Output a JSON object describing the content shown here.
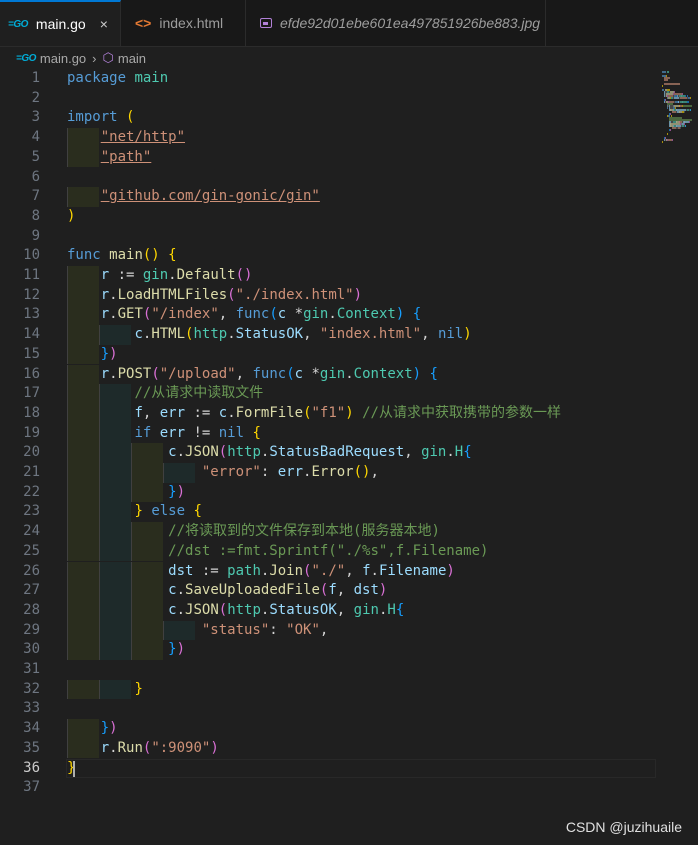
{
  "tabs": [
    {
      "label": "main.go",
      "icon": "go-icon",
      "active": true,
      "close": "×"
    },
    {
      "label": "index.html",
      "icon": "html-icon",
      "active": false
    },
    {
      "label": "efde92d01ebe601ea497851926be883.jpg",
      "icon": "image-icon",
      "active": false
    }
  ],
  "breadcrumb": {
    "file": "main.go",
    "symbol": "main",
    "separator": "›"
  },
  "editor": {
    "current_line": 36,
    "lines": [
      [
        [
          "kw",
          "package"
        ],
        [
          "pl",
          " "
        ],
        [
          "ty",
          "main"
        ]
      ],
      [],
      [
        [
          "kw",
          "import"
        ],
        [
          "pl",
          " "
        ],
        [
          "b1",
          "("
        ]
      ],
      [
        [
          "pl",
          "    "
        ],
        [
          "st",
          "\"net/http\""
        ]
      ],
      [
        [
          "pl",
          "    "
        ],
        [
          "st",
          "\"path\""
        ]
      ],
      [],
      [
        [
          "pl",
          "    "
        ],
        [
          "st",
          "\"github.com/gin-gonic/gin\""
        ]
      ],
      [
        [
          "b1",
          ")"
        ]
      ],
      [],
      [
        [
          "kw",
          "func"
        ],
        [
          "pl",
          " "
        ],
        [
          "fn",
          "main"
        ],
        [
          "b1",
          "()"
        ],
        [
          "pl",
          " "
        ],
        [
          "b1",
          "{"
        ]
      ],
      [
        [
          "pl",
          "    "
        ],
        [
          "id",
          "r"
        ],
        [
          "pl",
          " := "
        ],
        [
          "ty",
          "gin"
        ],
        [
          "pl",
          "."
        ],
        [
          "fn",
          "Default"
        ],
        [
          "b2",
          "()"
        ]
      ],
      [
        [
          "pl",
          "    "
        ],
        [
          "id",
          "r"
        ],
        [
          "pl",
          "."
        ],
        [
          "fn",
          "LoadHTMLFiles"
        ],
        [
          "b2",
          "("
        ],
        [
          "st",
          "\"./index.html\""
        ],
        [
          "b2",
          ")"
        ]
      ],
      [
        [
          "pl",
          "    "
        ],
        [
          "id",
          "r"
        ],
        [
          "pl",
          "."
        ],
        [
          "fn",
          "GET"
        ],
        [
          "b2",
          "("
        ],
        [
          "st",
          "\"/index\""
        ],
        [
          "pl",
          ", "
        ],
        [
          "kw",
          "func"
        ],
        [
          "b3",
          "("
        ],
        [
          "id",
          "c"
        ],
        [
          "pl",
          " *"
        ],
        [
          "ty",
          "gin"
        ],
        [
          "pl",
          "."
        ],
        [
          "ty",
          "Context"
        ],
        [
          "b3",
          ")"
        ],
        [
          "pl",
          " "
        ],
        [
          "b3",
          "{"
        ]
      ],
      [
        [
          "pl",
          "        "
        ],
        [
          "id",
          "c"
        ],
        [
          "pl",
          "."
        ],
        [
          "fn",
          "HTML"
        ],
        [
          "b1",
          "("
        ],
        [
          "ty",
          "http"
        ],
        [
          "pl",
          "."
        ],
        [
          "id",
          "StatusOK"
        ],
        [
          "pl",
          ", "
        ],
        [
          "st",
          "\"index.html\""
        ],
        [
          "pl",
          ", "
        ],
        [
          "kw",
          "nil"
        ],
        [
          "b1",
          ")"
        ]
      ],
      [
        [
          "pl",
          "    "
        ],
        [
          "b3",
          "}"
        ],
        [
          "b2",
          ")"
        ]
      ],
      [
        [
          "pl",
          "    "
        ],
        [
          "id",
          "r"
        ],
        [
          "pl",
          "."
        ],
        [
          "fn",
          "POST"
        ],
        [
          "b2",
          "("
        ],
        [
          "st",
          "\"/upload\""
        ],
        [
          "pl",
          ", "
        ],
        [
          "kw",
          "func"
        ],
        [
          "b3",
          "("
        ],
        [
          "id",
          "c"
        ],
        [
          "pl",
          " *"
        ],
        [
          "ty",
          "gin"
        ],
        [
          "pl",
          "."
        ],
        [
          "ty",
          "Context"
        ],
        [
          "b3",
          ")"
        ],
        [
          "pl",
          " "
        ],
        [
          "b3",
          "{"
        ]
      ],
      [
        [
          "pl",
          "        "
        ],
        [
          "cm",
          "//从请求中读取文件"
        ]
      ],
      [
        [
          "pl",
          "        "
        ],
        [
          "id",
          "f"
        ],
        [
          "pl",
          ", "
        ],
        [
          "id",
          "err"
        ],
        [
          "pl",
          " := "
        ],
        [
          "id",
          "c"
        ],
        [
          "pl",
          "."
        ],
        [
          "fn",
          "FormFile"
        ],
        [
          "b1",
          "("
        ],
        [
          "st",
          "\"f1\""
        ],
        [
          "b1",
          ")"
        ],
        [
          "pl",
          " "
        ],
        [
          "cm",
          "//从请求中获取携带的参数一样"
        ]
      ],
      [
        [
          "pl",
          "        "
        ],
        [
          "kw",
          "if"
        ],
        [
          "pl",
          " "
        ],
        [
          "id",
          "err"
        ],
        [
          "pl",
          " != "
        ],
        [
          "kw",
          "nil"
        ],
        [
          "pl",
          " "
        ],
        [
          "b1",
          "{"
        ]
      ],
      [
        [
          "pl",
          "            "
        ],
        [
          "id",
          "c"
        ],
        [
          "pl",
          "."
        ],
        [
          "fn",
          "JSON"
        ],
        [
          "b2",
          "("
        ],
        [
          "ty",
          "http"
        ],
        [
          "pl",
          "."
        ],
        [
          "id",
          "StatusBadRequest"
        ],
        [
          "pl",
          ", "
        ],
        [
          "ty",
          "gin"
        ],
        [
          "pl",
          "."
        ],
        [
          "ty",
          "H"
        ],
        [
          "b3",
          "{"
        ]
      ],
      [
        [
          "pl",
          "                "
        ],
        [
          "st",
          "\"error\""
        ],
        [
          "pl",
          ": "
        ],
        [
          "id",
          "err"
        ],
        [
          "pl",
          "."
        ],
        [
          "fn",
          "Error"
        ],
        [
          "b1",
          "()"
        ],
        [
          "pl",
          ","
        ]
      ],
      [
        [
          "pl",
          "            "
        ],
        [
          "b3",
          "}"
        ],
        [
          "b2",
          ")"
        ]
      ],
      [
        [
          "pl",
          "        "
        ],
        [
          "b1",
          "}"
        ],
        [
          "pl",
          " "
        ],
        [
          "kw",
          "else"
        ],
        [
          "pl",
          " "
        ],
        [
          "b1",
          "{"
        ]
      ],
      [
        [
          "pl",
          "            "
        ],
        [
          "cm",
          "//将读取到的文件保存到本地(服务器本地)"
        ]
      ],
      [
        [
          "pl",
          "            "
        ],
        [
          "cm",
          "//dst :=fmt.Sprintf(\"./%s\",f.Filename)"
        ]
      ],
      [
        [
          "pl",
          "            "
        ],
        [
          "id",
          "dst"
        ],
        [
          "pl",
          " := "
        ],
        [
          "ty",
          "path"
        ],
        [
          "pl",
          "."
        ],
        [
          "fn",
          "Join"
        ],
        [
          "b2",
          "("
        ],
        [
          "st",
          "\"./\""
        ],
        [
          "pl",
          ", "
        ],
        [
          "id",
          "f"
        ],
        [
          "pl",
          "."
        ],
        [
          "id",
          "Filename"
        ],
        [
          "b2",
          ")"
        ]
      ],
      [
        [
          "pl",
          "            "
        ],
        [
          "id",
          "c"
        ],
        [
          "pl",
          "."
        ],
        [
          "fn",
          "SaveUploadedFile"
        ],
        [
          "b2",
          "("
        ],
        [
          "id",
          "f"
        ],
        [
          "pl",
          ", "
        ],
        [
          "id",
          "dst"
        ],
        [
          "b2",
          ")"
        ]
      ],
      [
        [
          "pl",
          "            "
        ],
        [
          "id",
          "c"
        ],
        [
          "pl",
          "."
        ],
        [
          "fn",
          "JSON"
        ],
        [
          "b2",
          "("
        ],
        [
          "ty",
          "http"
        ],
        [
          "pl",
          "."
        ],
        [
          "id",
          "StatusOK"
        ],
        [
          "pl",
          ", "
        ],
        [
          "ty",
          "gin"
        ],
        [
          "pl",
          "."
        ],
        [
          "ty",
          "H"
        ],
        [
          "b3",
          "{"
        ]
      ],
      [
        [
          "pl",
          "                "
        ],
        [
          "st",
          "\"status\""
        ],
        [
          "pl",
          ": "
        ],
        [
          "st",
          "\"OK\""
        ],
        [
          "pl",
          ","
        ]
      ],
      [
        [
          "pl",
          "            "
        ],
        [
          "b3",
          "}"
        ],
        [
          "b2",
          ")"
        ]
      ],
      [],
      [
        [
          "pl",
          "        "
        ],
        [
          "b1",
          "}"
        ]
      ],
      [],
      [
        [
          "pl",
          "    "
        ],
        [
          "b3",
          "}"
        ],
        [
          "b2",
          ")"
        ]
      ],
      [
        [
          "pl",
          "    "
        ],
        [
          "id",
          "r"
        ],
        [
          "pl",
          "."
        ],
        [
          "fn",
          "Run"
        ],
        [
          "b2",
          "("
        ],
        [
          "st",
          "\":9090\""
        ],
        [
          "b2",
          ")"
        ]
      ],
      [
        [
          "b1",
          "}"
        ]
      ],
      []
    ]
  },
  "watermark": "CSDN @juzihuaile"
}
